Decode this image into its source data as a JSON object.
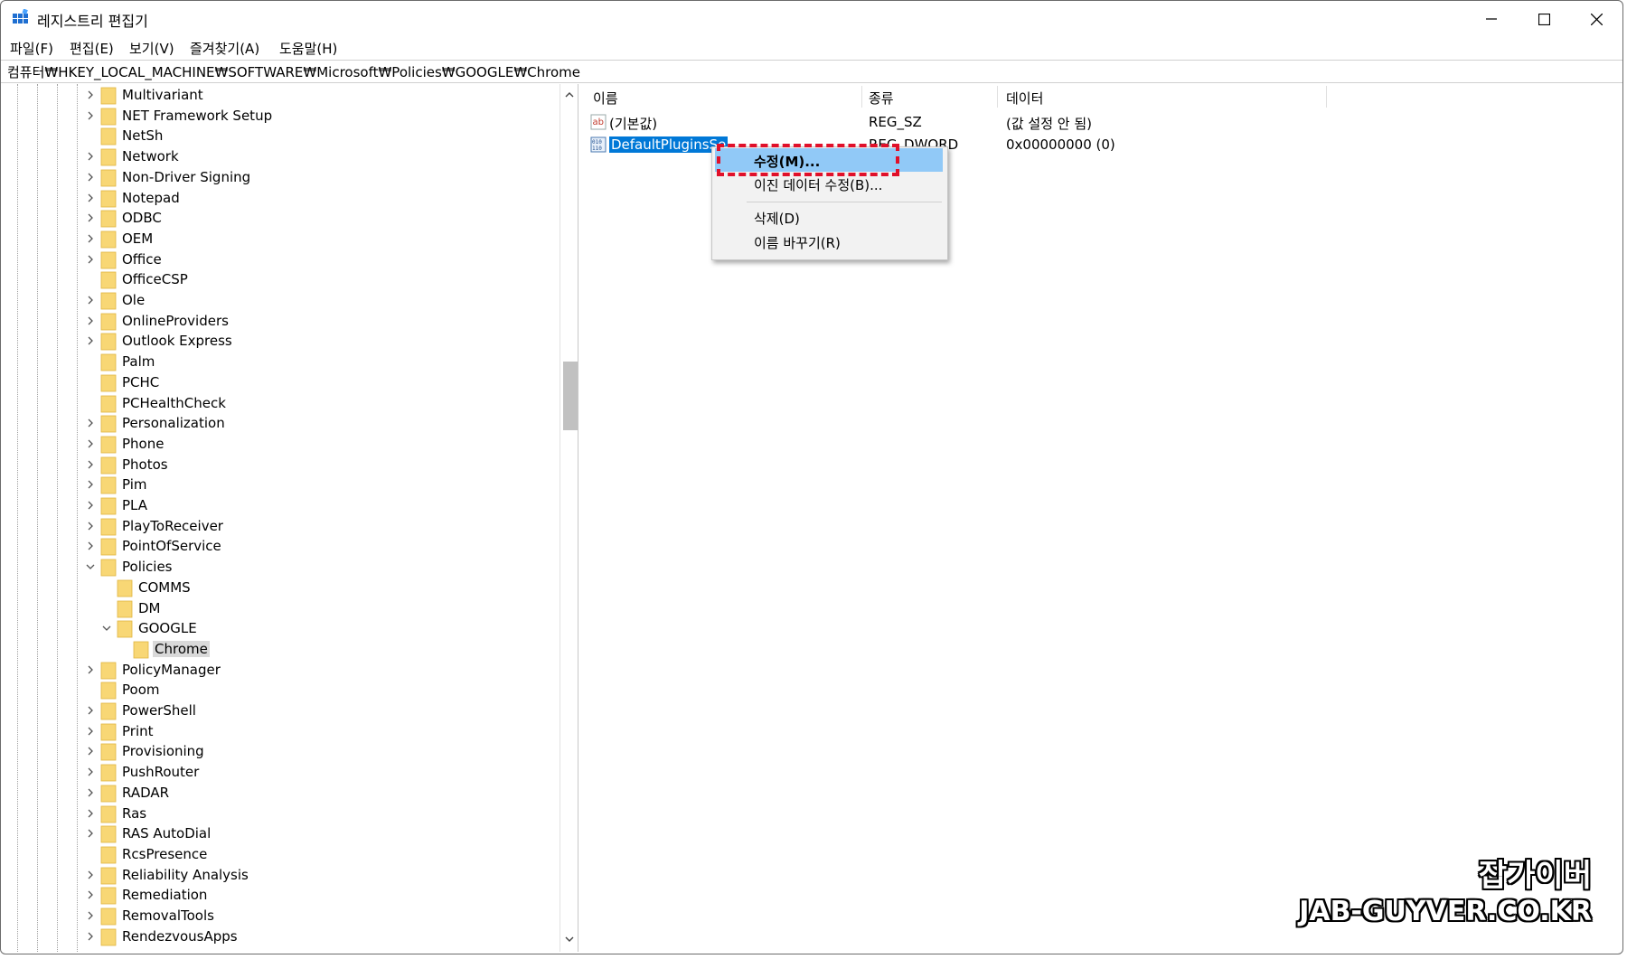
{
  "window": {
    "title": "레지스트리 편집기"
  },
  "menu": [
    {
      "label": "파일(F)"
    },
    {
      "label": "편집(E)"
    },
    {
      "label": "보기(V)"
    },
    {
      "label": "즐겨찾기(A)"
    },
    {
      "label": "도움말(H)"
    }
  ],
  "address": "컴퓨터₩HKEY_LOCAL_MACHINE₩SOFTWARE₩Microsoft₩Policies₩GOOGLE₩Chrome",
  "tree": [
    {
      "label": "Multivariant",
      "expander": "collapsed",
      "depth": 0
    },
    {
      "label": "NET Framework Setup",
      "expander": "collapsed",
      "depth": 0
    },
    {
      "label": "NetSh",
      "expander": "none",
      "depth": 0
    },
    {
      "label": "Network",
      "expander": "collapsed",
      "depth": 0
    },
    {
      "label": "Non-Driver Signing",
      "expander": "collapsed",
      "depth": 0
    },
    {
      "label": "Notepad",
      "expander": "collapsed",
      "depth": 0
    },
    {
      "label": "ODBC",
      "expander": "collapsed",
      "depth": 0
    },
    {
      "label": "OEM",
      "expander": "collapsed",
      "depth": 0
    },
    {
      "label": "Office",
      "expander": "collapsed",
      "depth": 0
    },
    {
      "label": "OfficeCSP",
      "expander": "none",
      "depth": 0
    },
    {
      "label": "Ole",
      "expander": "collapsed",
      "depth": 0
    },
    {
      "label": "OnlineProviders",
      "expander": "collapsed",
      "depth": 0
    },
    {
      "label": "Outlook Express",
      "expander": "collapsed",
      "depth": 0
    },
    {
      "label": "Palm",
      "expander": "none",
      "depth": 0
    },
    {
      "label": "PCHC",
      "expander": "none",
      "depth": 0
    },
    {
      "label": "PCHealthCheck",
      "expander": "none",
      "depth": 0
    },
    {
      "label": "Personalization",
      "expander": "collapsed",
      "depth": 0
    },
    {
      "label": "Phone",
      "expander": "collapsed",
      "depth": 0
    },
    {
      "label": "Photos",
      "expander": "collapsed",
      "depth": 0
    },
    {
      "label": "Pim",
      "expander": "collapsed",
      "depth": 0
    },
    {
      "label": "PLA",
      "expander": "collapsed",
      "depth": 0
    },
    {
      "label": "PlayToReceiver",
      "expander": "collapsed",
      "depth": 0
    },
    {
      "label": "PointOfService",
      "expander": "collapsed",
      "depth": 0
    },
    {
      "label": "Policies",
      "expander": "expanded",
      "depth": 0
    },
    {
      "label": "COMMS",
      "expander": "none",
      "depth": 1
    },
    {
      "label": "DM",
      "expander": "none",
      "depth": 1
    },
    {
      "label": "GOOGLE",
      "expander": "expanded",
      "depth": 1
    },
    {
      "label": "Chrome",
      "expander": "none",
      "depth": 2,
      "selected": true
    },
    {
      "label": "PolicyManager",
      "expander": "collapsed",
      "depth": 0
    },
    {
      "label": "Poom",
      "expander": "none",
      "depth": 0
    },
    {
      "label": "PowerShell",
      "expander": "collapsed",
      "depth": 0
    },
    {
      "label": "Print",
      "expander": "collapsed",
      "depth": 0
    },
    {
      "label": "Provisioning",
      "expander": "collapsed",
      "depth": 0
    },
    {
      "label": "PushRouter",
      "expander": "collapsed",
      "depth": 0
    },
    {
      "label": "RADAR",
      "expander": "collapsed",
      "depth": 0
    },
    {
      "label": "Ras",
      "expander": "collapsed",
      "depth": 0
    },
    {
      "label": "RAS AutoDial",
      "expander": "collapsed",
      "depth": 0
    },
    {
      "label": "RcsPresence",
      "expander": "none",
      "depth": 0
    },
    {
      "label": "Reliability Analysis",
      "expander": "collapsed",
      "depth": 0
    },
    {
      "label": "Remediation",
      "expander": "collapsed",
      "depth": 0
    },
    {
      "label": "RemovalTools",
      "expander": "collapsed",
      "depth": 0
    },
    {
      "label": "RendezvousApps",
      "expander": "collapsed",
      "depth": 0
    }
  ],
  "columns": {
    "name": "이름",
    "type": "종류",
    "data": "데이터"
  },
  "values": [
    {
      "name": "(기본값)",
      "type": "REG_SZ",
      "data": "(값 설정 안 됨)",
      "icon": "string-value-icon"
    },
    {
      "name": "DefaultPluginsSe",
      "type": "REG_DWORD",
      "data": "0x00000000 (0)",
      "icon": "binary-value-icon",
      "selected": true
    }
  ],
  "context_menu": [
    {
      "label": "수정(M)...",
      "highlighted": true
    },
    {
      "label": "이진 데이터 수정(B)..."
    },
    {
      "label": "삭제(D)"
    },
    {
      "label": "이름 바꾸기(R)"
    }
  ],
  "watermark": {
    "line1": "잡가이버",
    "line2": "JAB-GUYVER.CO.KR"
  }
}
